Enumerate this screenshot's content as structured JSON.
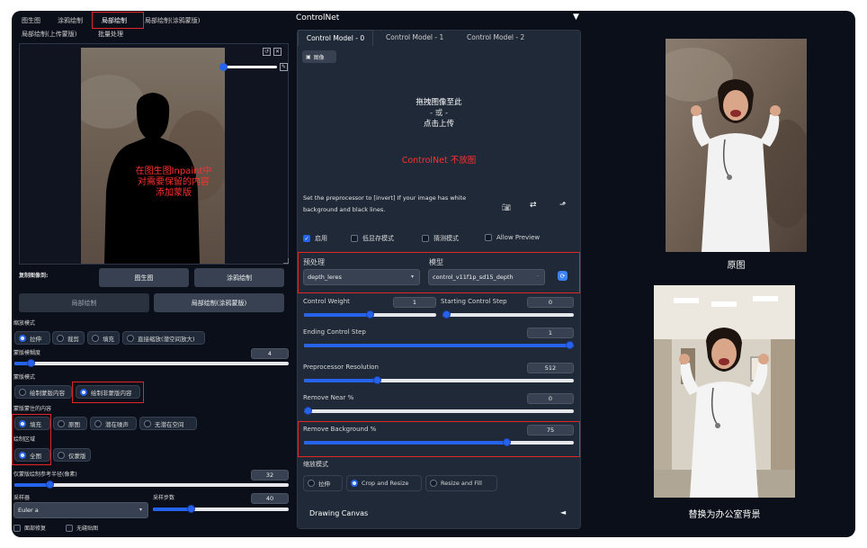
{
  "left": {
    "tabs": [
      "图生图",
      "涂鸦绘制",
      "局部绘制",
      "局部绘制(涂鸦蒙版)"
    ],
    "tabs_row2": [
      "局部绘制(上传蒙版)",
      "批量处理"
    ],
    "canvas_annotation": "在图生图Inpaint中\n对需要保留的内容\n添加蒙版",
    "copy_image_to_label": "复制图像到:",
    "copy_buttons": [
      "图生图",
      "涂鸦绘制",
      "局部绘制",
      "局部绘制(涂鸦蒙版)"
    ],
    "resize_mode": {
      "label": "缩放模式",
      "options": [
        "拉伸",
        "裁剪",
        "填充",
        "直接缩放(潜空间放大)"
      ]
    },
    "mask_blur": {
      "label": "蒙版模糊度",
      "value": "4",
      "fraction": 0.06
    },
    "mask_mode": {
      "label": "蒙版模式",
      "options": [
        "绘制蒙版内容",
        "绘制非蒙版内容"
      ]
    },
    "masked_content": {
      "label": "蒙版蒙住的内容",
      "options": [
        "填充",
        "原图",
        "潜在噪声",
        "无潜在空间"
      ]
    },
    "inpaint_area": {
      "label": "绘制区域",
      "options": [
        "全图",
        "仅蒙版"
      ]
    },
    "only_masked_padding": {
      "label": "仅蒙版绘制参考半径(像素)",
      "value": "32",
      "fraction": 0.13
    },
    "sampler": {
      "label": "采样器",
      "value": "Euler a"
    },
    "steps": {
      "label": "采样步数",
      "value": "40",
      "fraction": 0.28
    },
    "checks": [
      "面部修复",
      "无缝贴图"
    ]
  },
  "controlnet": {
    "title": "ControlNet",
    "collapse_icon": "triangle-down",
    "tabs": [
      "Control Model - 0",
      "Control Model - 1",
      "Control Model - 2"
    ],
    "image_tab": "图像",
    "drop_text": [
      "拖拽图像至此",
      "- 或 -",
      "点击上传"
    ],
    "no_image_note": "ControlNet 不放图",
    "hint": "Set the preprocessor to [invert] If your image has white background and black lines.",
    "checks": [
      {
        "label": "启用",
        "checked": true
      },
      {
        "label": "低显存模式",
        "checked": false
      },
      {
        "label": "猜测模式",
        "checked": false
      },
      {
        "label": "Allow Preview",
        "checked": false
      }
    ],
    "preprocessor": {
      "label": "预处理",
      "value": "depth_leres"
    },
    "model": {
      "label": "模型",
      "value": "control_v11f1p_sd15_depth"
    },
    "control_weight": {
      "label": "Control Weight",
      "value": "1",
      "fraction": 0.5
    },
    "start_step": {
      "label": "Starting Control Step",
      "value": "0",
      "fraction": 0.0
    },
    "end_step": {
      "label": "Ending Control Step",
      "value": "1",
      "fraction": 1.0
    },
    "pre_res": {
      "label": "Preprocessor Resolution",
      "value": "512",
      "fraction": 0.27
    },
    "remove_near": {
      "label": "Remove Near %",
      "value": "0",
      "fraction": 0.0
    },
    "remove_bg": {
      "label": "Remove Background %",
      "value": "75",
      "fraction": 0.75
    },
    "resize_mode": {
      "label": "缩放模式",
      "options": [
        "拉伸",
        "Crop and Resize",
        "Resize and Fill"
      ]
    },
    "drawing_canvas": "Drawing Canvas",
    "drawing_canvas_icon": "triangle-left"
  },
  "right": {
    "caption_top": "原图",
    "caption_bottom": "替换为办公室背景"
  },
  "colors": {
    "accent": "#2563eb",
    "highlight": "#e02626",
    "background": "#0b0f19"
  }
}
